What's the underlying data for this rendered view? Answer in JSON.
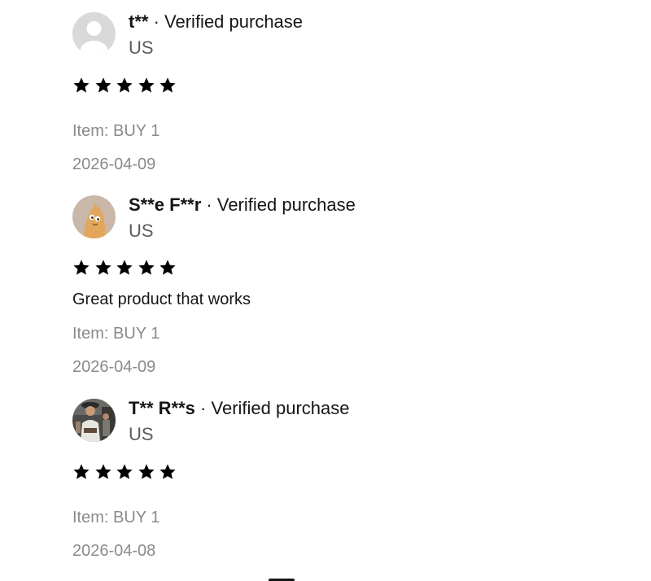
{
  "reviews": [
    {
      "name": "t**",
      "separator": "·",
      "verified": "Verified purchase",
      "country": "US",
      "avatar_icon": "default-user-icon",
      "rating": 5,
      "text": "",
      "item": "Item: BUY 1",
      "date": "2026-04-09"
    },
    {
      "name": "S**e F**r",
      "separator": "·",
      "verified": "Verified purchase",
      "country": "US",
      "avatar_icon": "cartoon-avatar-icon",
      "rating": 5,
      "text": "Great product that works",
      "item": "Item: BUY 1",
      "date": "2026-04-09"
    },
    {
      "name": "T** R**s",
      "separator": "·",
      "verified": "Verified purchase",
      "country": "US",
      "avatar_icon": "photo-avatar-icon",
      "rating": 5,
      "text": "",
      "item": "Item: BUY 1",
      "date": "2026-04-08"
    }
  ],
  "colors": {
    "text": "#161616",
    "muted": "#8a8a8a",
    "star": "#000000"
  }
}
